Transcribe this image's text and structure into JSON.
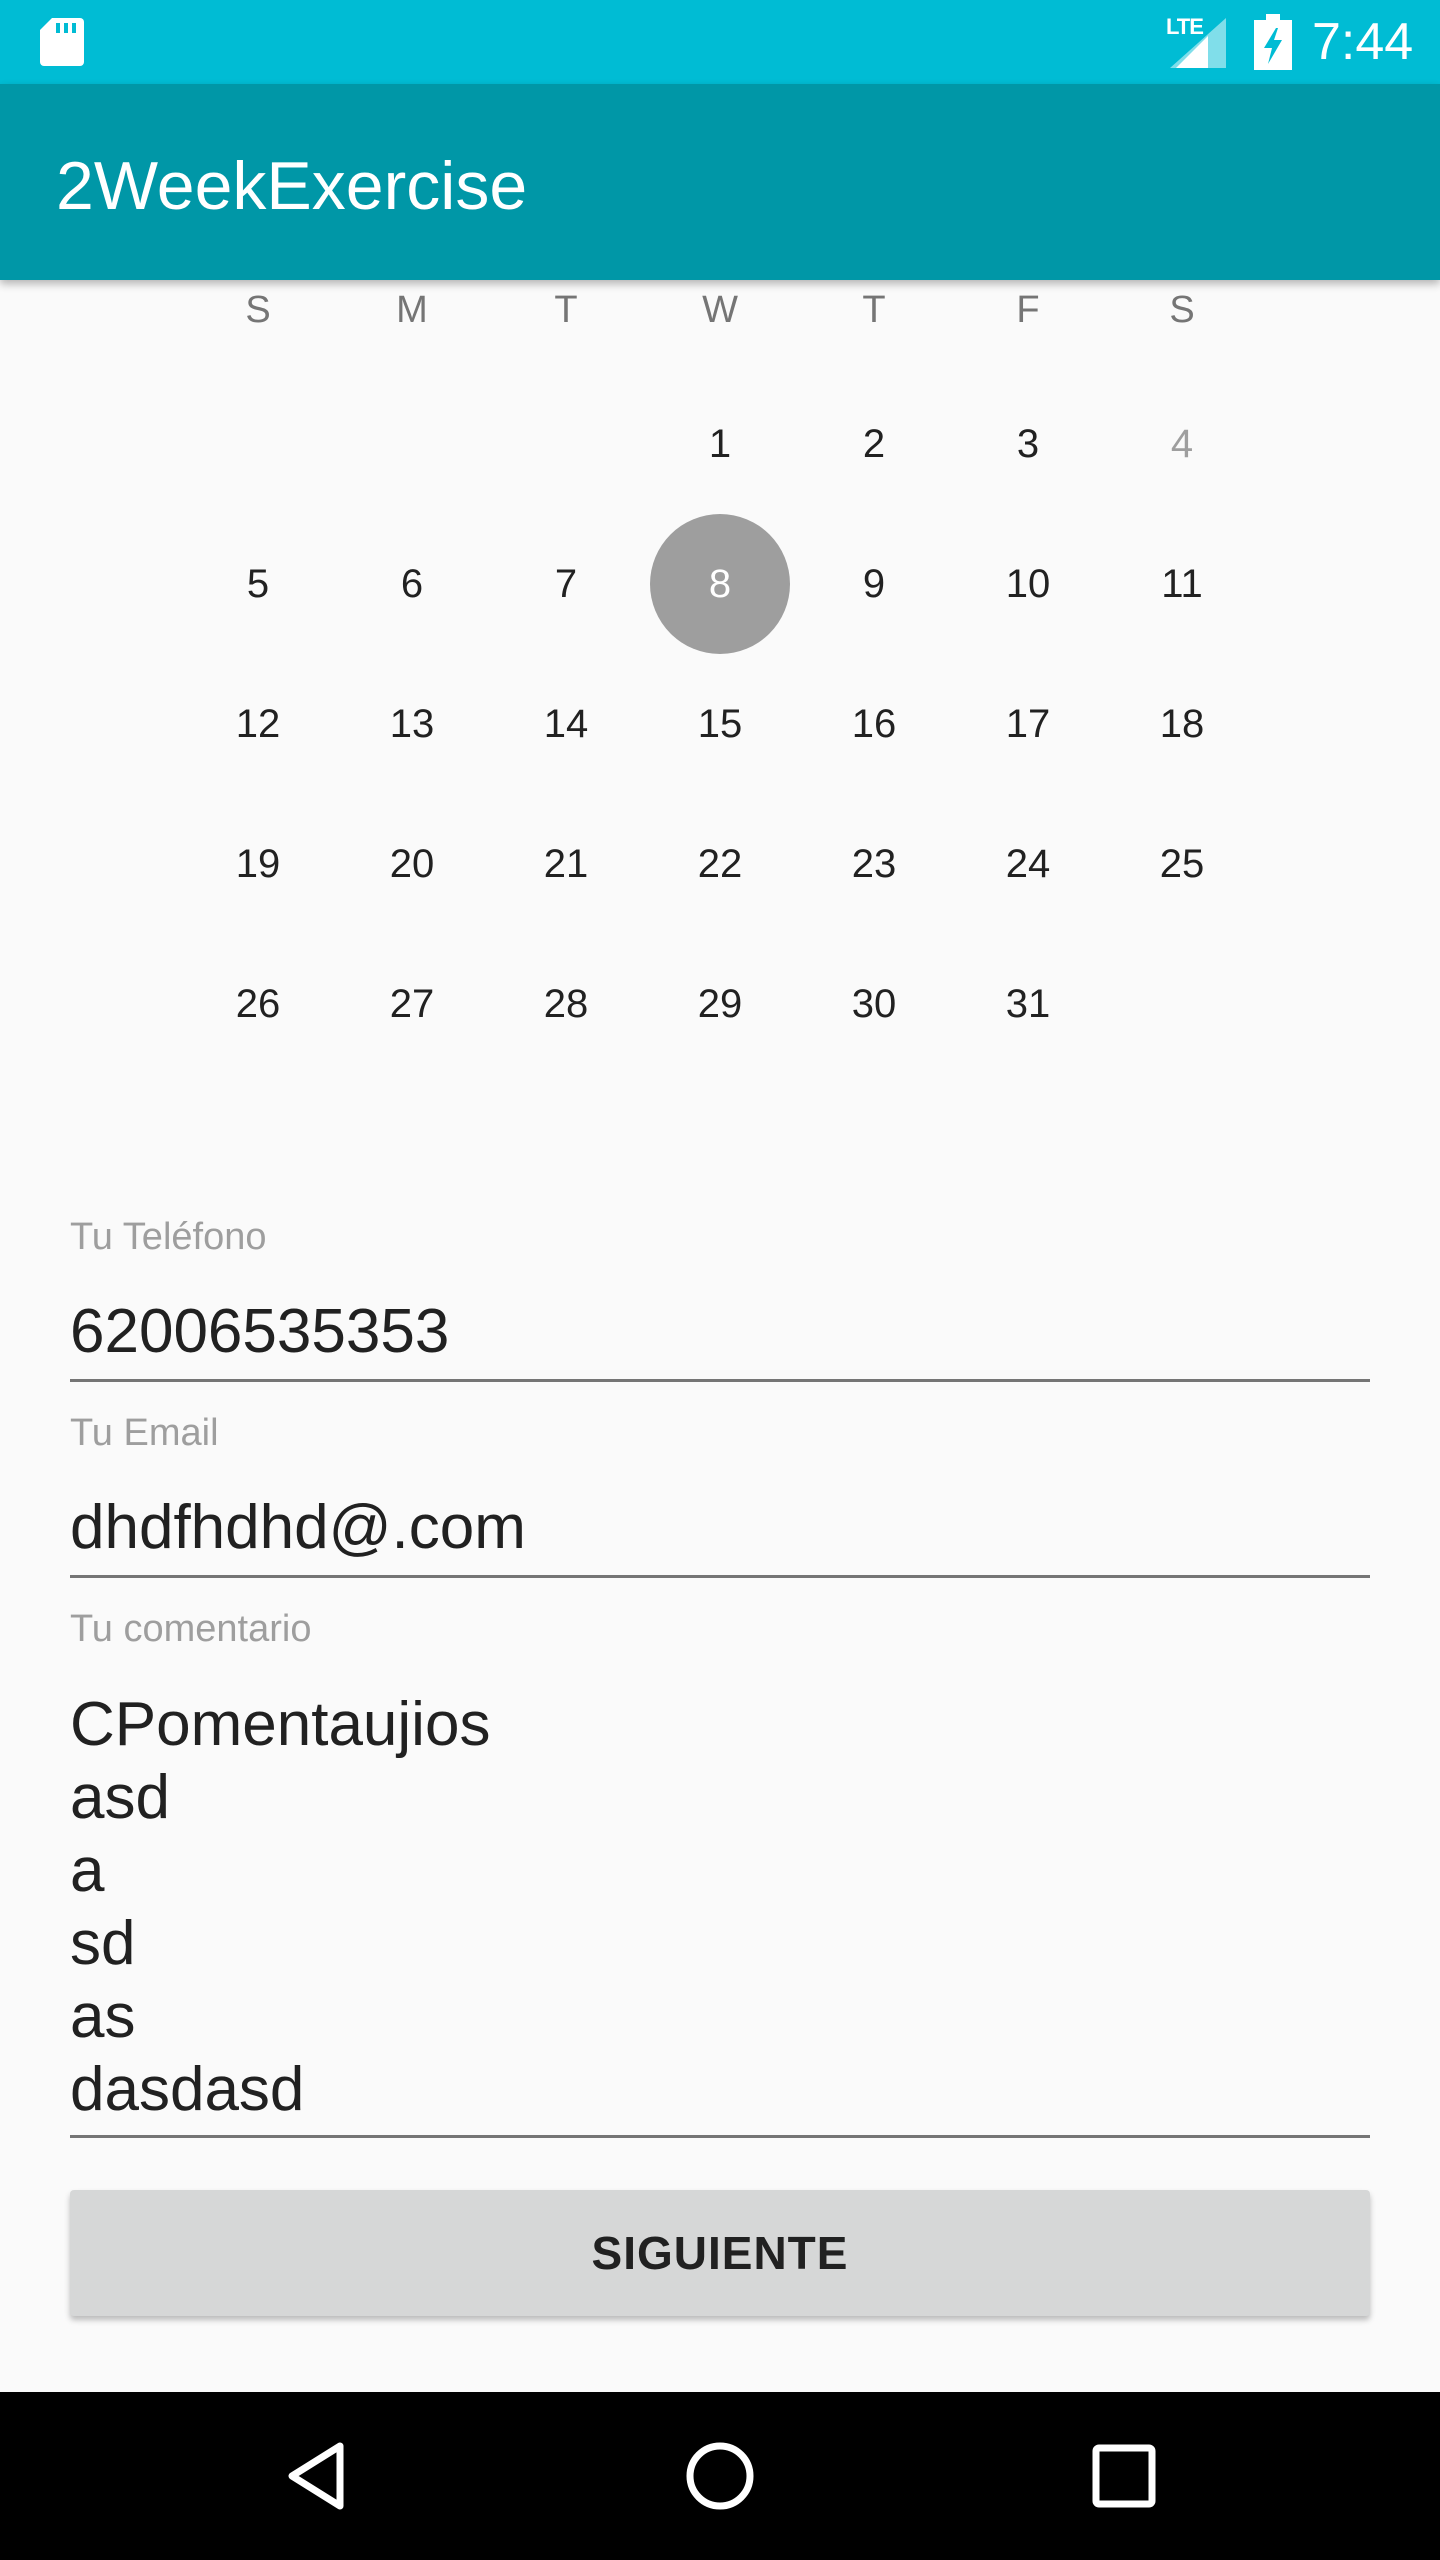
{
  "status_bar": {
    "network": "LTE",
    "time": "7:44",
    "icons": [
      "sd-card-icon",
      "signal-icon",
      "battery-charging-icon"
    ]
  },
  "app_bar": {
    "title": "2WeekExercise"
  },
  "calendar": {
    "weekdays": [
      "S",
      "M",
      "T",
      "W",
      "T",
      "F",
      "S"
    ],
    "weeks": [
      [
        "",
        "",
        "",
        "1",
        "2",
        "3",
        "4"
      ],
      [
        "5",
        "6",
        "7",
        "8",
        "9",
        "10",
        "11"
      ],
      [
        "12",
        "13",
        "14",
        "15",
        "16",
        "17",
        "18"
      ],
      [
        "19",
        "20",
        "21",
        "22",
        "23",
        "24",
        "25"
      ],
      [
        "26",
        "27",
        "28",
        "29",
        "30",
        "31",
        ""
      ]
    ],
    "selected_day": "8",
    "dimmed_day": "4",
    "selected_color": "#9e9e9e"
  },
  "form": {
    "phone": {
      "label": "Tu Teléfono",
      "value": "62006535353"
    },
    "email": {
      "label": "Tu Email",
      "value": "dhdfhdhd@.com"
    },
    "comment": {
      "label": "Tu comentario",
      "value": "CPomentaujios\nasd\na\nsd\nas\ndasdasd"
    },
    "submit_label": "SIGUIENTE"
  },
  "nav_bar": {
    "icons": [
      "back-icon",
      "home-icon",
      "recents-icon"
    ]
  },
  "colors": {
    "status_bar": "#00bcd4",
    "app_bar": "#0097a7",
    "background": "#fafafa",
    "button": "#d6d7d7"
  }
}
